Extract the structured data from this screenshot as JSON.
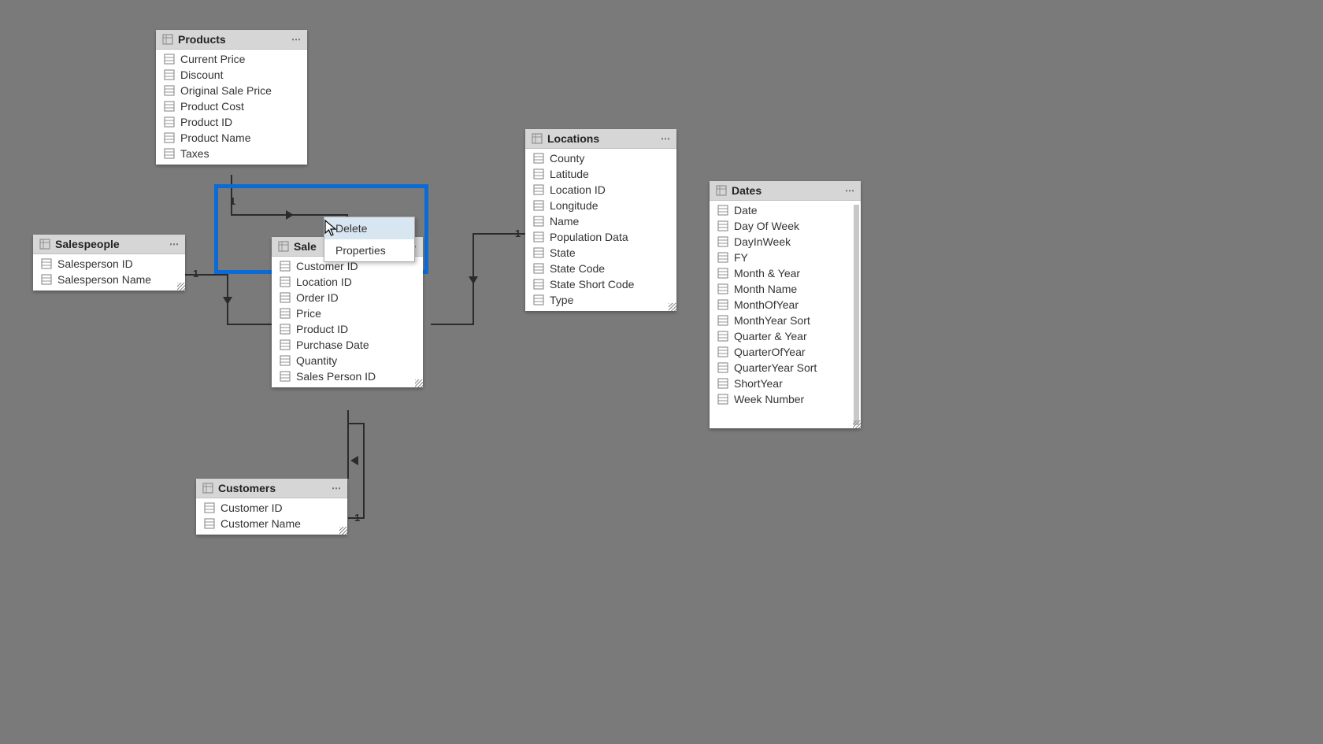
{
  "tables": {
    "products": {
      "title": "Products",
      "fields": [
        "Current Price",
        "Discount",
        "Original Sale Price",
        "Product Cost",
        "Product ID",
        "Product Name",
        "Taxes"
      ]
    },
    "salespeople": {
      "title": "Salespeople",
      "fields": [
        "Salesperson ID",
        "Salesperson Name"
      ]
    },
    "sales": {
      "title": "Sale",
      "fields": [
        "Customer ID",
        "Location ID",
        "Order ID",
        "Price",
        "Product ID",
        "Purchase Date",
        "Quantity",
        "Sales Person ID"
      ]
    },
    "customers": {
      "title": "Customers",
      "fields": [
        "Customer ID",
        "Customer Name"
      ]
    },
    "locations": {
      "title": "Locations",
      "fields": [
        "County",
        "Latitude",
        "Location ID",
        "Longitude",
        "Name",
        "Population Data",
        "State",
        "State Code",
        "State Short Code",
        "Type"
      ]
    },
    "dates": {
      "title": "Dates",
      "fields": [
        "Date",
        "Day Of Week",
        "DayInWeek",
        "FY",
        "Month & Year",
        "Month Name",
        "MonthOfYear",
        "MonthYear Sort",
        "Quarter & Year",
        "QuarterOfYear",
        "QuarterYear Sort",
        "ShortYear",
        "Week Number"
      ]
    }
  },
  "context_menu": {
    "items": [
      "Delete",
      "Properties"
    ]
  },
  "cardinality_label": "1",
  "menu_dots": "⋯"
}
